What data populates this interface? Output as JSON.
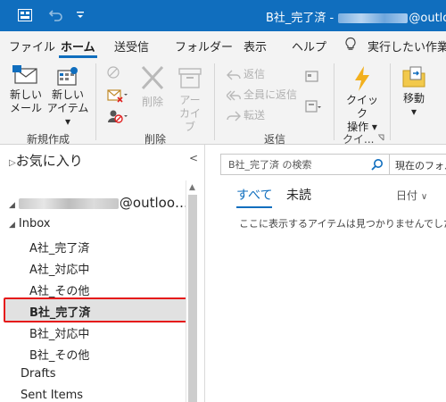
{
  "titlebar": {
    "title_prefix": "B社_完了済 - ",
    "title_suffix": "@outlook"
  },
  "ribbon_tabs": [
    "ファイル",
    "ホーム",
    "送受信",
    "フォルダー",
    "表示",
    "ヘルプ"
  ],
  "tell_me": "実行したい作業を",
  "ribbon": {
    "new_mail": [
      "新しい",
      "メール"
    ],
    "new_items": [
      "新しい",
      "アイテム ▾"
    ],
    "delete": "削除",
    "archive": [
      "アー",
      "カイブ"
    ],
    "reply": "返信",
    "reply_all": "全員に返信",
    "forward": "転送",
    "quick_steps": [
      "クイック",
      "操作 ▾"
    ],
    "move": [
      "移動",
      "▾"
    ],
    "groups": {
      "new": "新規作成",
      "delete": "削除",
      "respond": "返信",
      "quick": "クイ..."
    }
  },
  "folders": {
    "favorites": "お気に入り",
    "account_suffix": "@outloo…",
    "inbox": "Inbox",
    "items": [
      "A社_完了済",
      "A社_対応中",
      "A社_その他",
      "B社_完了済",
      "B社_対応中",
      "B社_その他"
    ],
    "drafts": "Drafts",
    "sent": "Sent Items"
  },
  "list": {
    "search_placeholder": "B社_完了済 の検索",
    "scope": "現在のフォルダー",
    "filter_all": "すべて",
    "filter_unread": "未読",
    "sort": "日付",
    "empty": "ここに表示するアイテムは見つかりませんでした。"
  },
  "colors": {
    "titlebar": "#106ebe",
    "accent": "#106ebe",
    "selection_outline": "#e51a1a"
  }
}
